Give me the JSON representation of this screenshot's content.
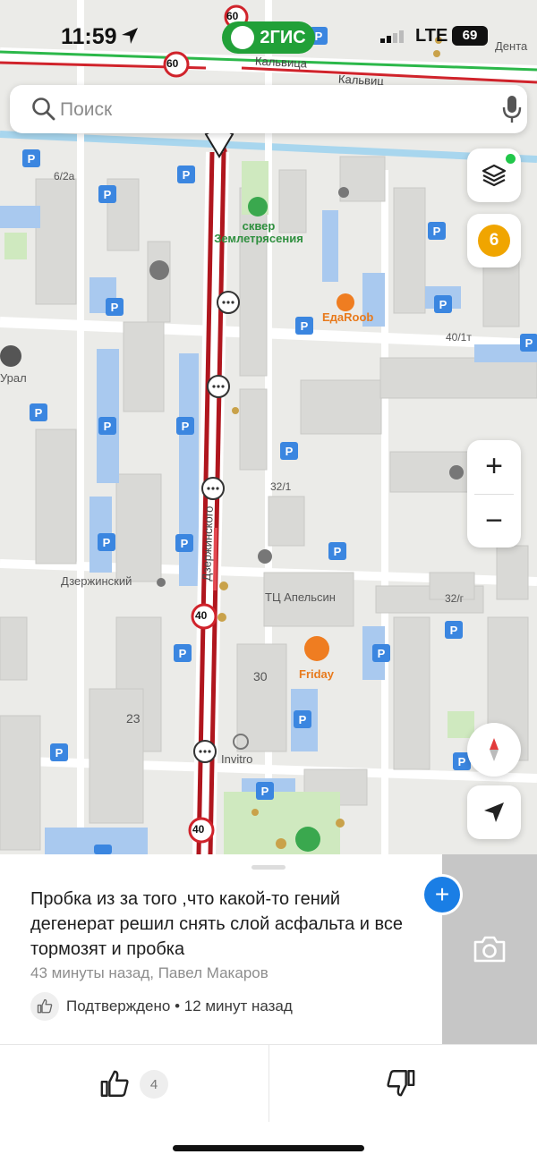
{
  "status_bar": {
    "time": "11:59",
    "brand": "2ГИС",
    "network": "LTE",
    "battery": "69"
  },
  "search": {
    "placeholder": "Поиск"
  },
  "map_controls": {
    "traffic_score": "6",
    "zoom_in": "+",
    "zoom_out": "−"
  },
  "map_labels": {
    "street_kalvica_1": "Кальвица",
    "street_kalvica_2": "Кальвиц",
    "street_dzerzhinskogo": "Дзержинского",
    "park": "сквер Землетрясения",
    "cafe_edaroob": "EдаRoob",
    "cafe_friday": "Friday",
    "shop_dzerzhinsky": "Дзержинский",
    "mall": "ТЦ Апельсин",
    "invitro": "Invitro",
    "ural": "Урал",
    "denta": "Дента",
    "addr_6_2a": "6/2а",
    "addr_40_1t": "40/1т",
    "addr_32_1": "32/1",
    "addr_32_g": "32/г",
    "addr_30": "30",
    "addr_23": "23",
    "speed_60a": "60",
    "speed_60b": "60",
    "speed_40a": "40",
    "speed_40b": "40"
  },
  "report": {
    "message": "Пробка из за того ,что какой-то гений дегенерат решил снять слой асфальта и все тормозят и пробка",
    "meta": "43 минуты назад, Павел Макаров",
    "confirmed": "Подтверждено • 12 минут назад",
    "likes": "4"
  },
  "colors": {
    "brand": "#21a038",
    "traffic_jam": "#b0161e",
    "parking": "#3b86e0",
    "accent": "#1a7ee5"
  }
}
